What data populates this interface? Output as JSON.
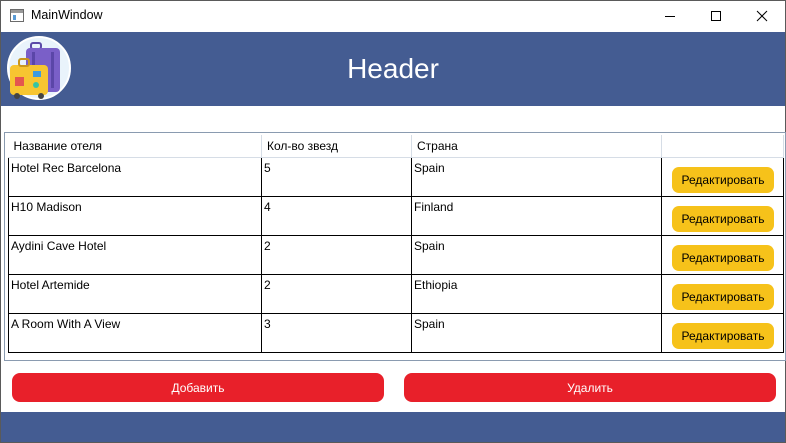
{
  "window": {
    "title": "MainWindow"
  },
  "header": {
    "title": "Header"
  },
  "table": {
    "columns": [
      "Название отеля",
      "Кол-во звезд",
      "Страна",
      ""
    ],
    "rows": [
      {
        "name": "Hotel Rec Barcelona",
        "stars": "5",
        "country": "Spain",
        "action": "Редактировать"
      },
      {
        "name": "H10 Madison",
        "stars": "4",
        "country": "Finland",
        "action": "Редактировать"
      },
      {
        "name": "Aydini Cave Hotel",
        "stars": "2",
        "country": "Spain",
        "action": "Редактировать"
      },
      {
        "name": "Hotel Artemide",
        "stars": "2",
        "country": "Ethiopia",
        "action": "Редактировать"
      },
      {
        "name": "A Room With A View",
        "stars": "3",
        "country": "Spain",
        "action": "Редактировать"
      }
    ]
  },
  "actions": {
    "add_label": "Добавить",
    "delete_label": "Удалить"
  },
  "colors": {
    "header_bg": "#445c92",
    "edit_button": "#f6c21a",
    "action_button": "#e8202a"
  }
}
